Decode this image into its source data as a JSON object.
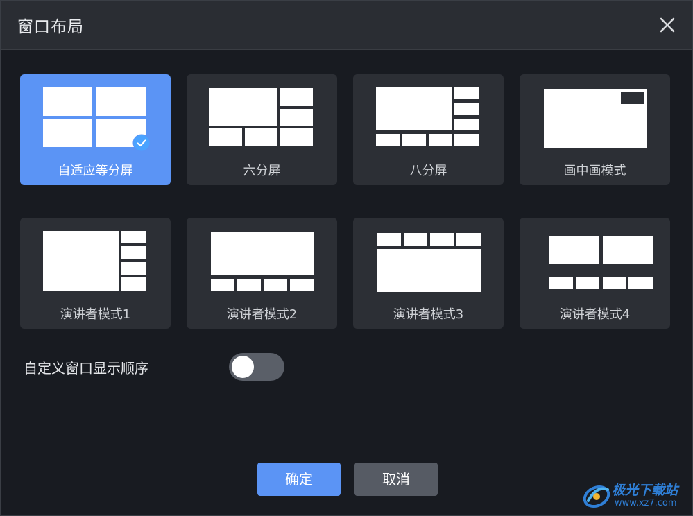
{
  "dialog": {
    "title": "窗口布局",
    "close_icon": "close-icon"
  },
  "layouts": [
    {
      "label": "自适应等分屏",
      "selected": true
    },
    {
      "label": "六分屏",
      "selected": false
    },
    {
      "label": "八分屏",
      "selected": false
    },
    {
      "label": "画中画模式",
      "selected": false
    },
    {
      "label": "演讲者模式1",
      "selected": false
    },
    {
      "label": "演讲者模式2",
      "selected": false
    },
    {
      "label": "演讲者模式3",
      "selected": false
    },
    {
      "label": "演讲者模式4",
      "selected": false
    }
  ],
  "custom_order": {
    "label": "自定义窗口显示顺序",
    "enabled": false
  },
  "buttons": {
    "ok": "确定",
    "cancel": "取消"
  },
  "watermark": {
    "name": "极光下载站",
    "url": "www.xz7.com"
  },
  "colors": {
    "accent": "#5b94f5",
    "card": "#2c2f35",
    "toggle_off": "#5a5f68"
  }
}
